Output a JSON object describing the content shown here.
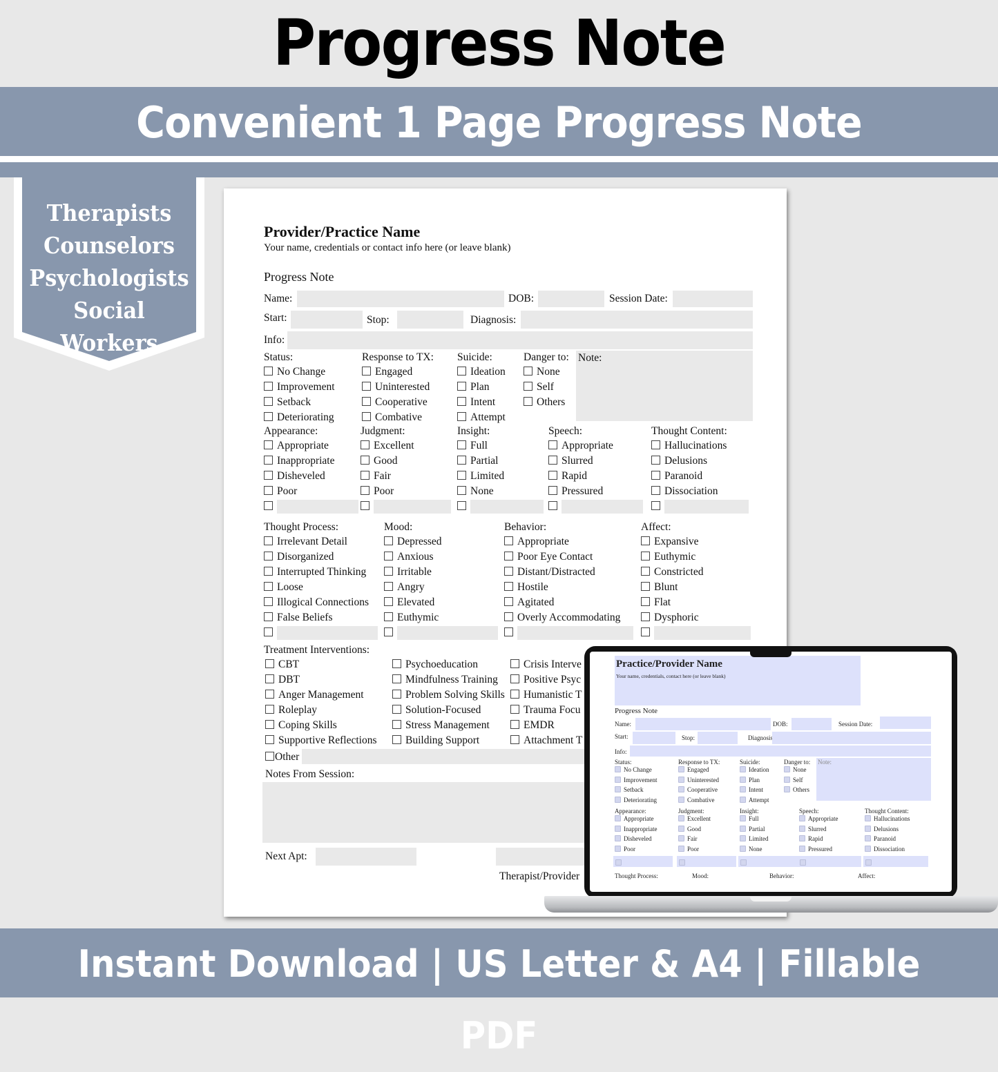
{
  "banner": {
    "title": "Progress Note",
    "subtitle": "Convenient 1 Page Progress Note",
    "audience": [
      "Therapists",
      "Counselors",
      "Psychologists",
      "Social Workers"
    ],
    "footer": "Instant Download | US Letter & A4 | Fillable PDF"
  },
  "colors": {
    "band": "#8897ad",
    "background": "#e8e8e8",
    "field_fill": "#e9e9e9",
    "laptop_field_fill": "#dde1fb"
  },
  "form": {
    "provider_name": "Provider/Practice Name",
    "provider_hint": "Your name, credentials or contact info here (or leave blank)",
    "section_title": "Progress Note",
    "labels": {
      "name": "Name:",
      "dob": "DOB:",
      "session_date": "Session Date:",
      "start": "Start:",
      "stop": "Stop:",
      "diagnosis": "Diagnosis:",
      "info": "Info:",
      "note": "Note:",
      "treatment": "Treatment Interventions:",
      "other": "Other",
      "notes_from_session": "Notes From Session:",
      "next_apt": "Next Apt:",
      "therapist": "Therapist/Provider"
    },
    "group1": [
      {
        "heading": "Status:",
        "items": [
          "No Change",
          "Improvement",
          "Setback",
          "Deteriorating"
        ]
      },
      {
        "heading": "Response to TX:",
        "items": [
          "Engaged",
          "Uninterested",
          "Cooperative",
          "Combative"
        ]
      },
      {
        "heading": "Suicide:",
        "items": [
          "Ideation",
          "Plan",
          "Intent",
          "Attempt"
        ]
      },
      {
        "heading": "Danger to:",
        "items": [
          "None",
          "Self",
          "Others"
        ]
      }
    ],
    "group2": [
      {
        "heading": "Appearance:",
        "items": [
          "Appropriate",
          "Inappropriate",
          "Disheveled",
          "Poor"
        ]
      },
      {
        "heading": "Judgment:",
        "items": [
          "Excellent",
          "Good",
          "Fair",
          "Poor"
        ]
      },
      {
        "heading": "Insight:",
        "items": [
          "Full",
          "Partial",
          "Limited",
          "None"
        ]
      },
      {
        "heading": "Speech:",
        "items": [
          "Appropriate",
          "Slurred",
          "Rapid",
          "Pressured"
        ]
      },
      {
        "heading": "Thought Content:",
        "items": [
          "Hallucinations",
          "Delusions",
          "Paranoid",
          "Dissociation"
        ]
      }
    ],
    "group3": [
      {
        "heading": "Thought Process:",
        "items": [
          "Irrelevant Detail",
          "Disorganized",
          "Interrupted Thinking",
          "Loose",
          "Illogical Connections",
          "False Beliefs"
        ]
      },
      {
        "heading": "Mood:",
        "items": [
          "Depressed",
          "Anxious",
          "Irritable",
          "Angry",
          "Elevated",
          "Euthymic"
        ]
      },
      {
        "heading": "Behavior:",
        "items": [
          "Appropriate",
          "Poor Eye Contact",
          "Distant/Distracted",
          "Hostile",
          "Agitated",
          "Overly Accommodating"
        ]
      },
      {
        "heading": "Affect:",
        "items": [
          "Expansive",
          "Euthymic",
          "Constricted",
          "Blunt",
          "Flat",
          "Dysphoric"
        ]
      }
    ],
    "treatment_columns": [
      [
        "CBT",
        "DBT",
        "Anger Management",
        "Roleplay",
        "Coping Skills",
        "Supportive Reflections"
      ],
      [
        "Psychoeducation",
        "Mindfulness Training",
        "Problem Solving Skills",
        "Solution-Focused",
        "Stress Management",
        "Building Support"
      ],
      [
        "Crisis Interve",
        "Positive Psyc",
        "Humanistic T",
        "Trauma Focu",
        "EMDR",
        "Attachment T"
      ]
    ]
  },
  "laptop_preview": {
    "provider_name": "Practice/Provider Name",
    "provider_hint": "Your name, credentials, contact here (or leave blank)",
    "section_title": "Progress Note",
    "labels": {
      "name": "Name:",
      "dob": "DOB:",
      "session_date": "Session Date:",
      "start": "Start:",
      "stop": "Stop:",
      "diagnosis": "Diagnosis:",
      "info": "Info:",
      "note": "Note:"
    },
    "group1": [
      {
        "heading": "Status:",
        "items": [
          "No Change",
          "Improvement",
          "Setback",
          "Deteriorating"
        ]
      },
      {
        "heading": "Response to TX:",
        "items": [
          "Engaged",
          "Uninterested",
          "Cooperative",
          "Combative"
        ]
      },
      {
        "heading": "Suicide:",
        "items": [
          "Ideation",
          "Plan",
          "Intent",
          "Attempt"
        ]
      },
      {
        "heading": "Danger to:",
        "items": [
          "None",
          "Self",
          "Others"
        ]
      }
    ],
    "group2": [
      {
        "heading": "Appearance:",
        "items": [
          "Appropriate",
          "Inappropriate",
          "Disheveled",
          "Poor"
        ]
      },
      {
        "heading": "Judgment:",
        "items": [
          "Excellent",
          "Good",
          "Fair",
          "Poor"
        ]
      },
      {
        "heading": "Insight:",
        "items": [
          "Full",
          "Partial",
          "Limited",
          "None"
        ]
      },
      {
        "heading": "Speech:",
        "items": [
          "Appropriate",
          "Slurred",
          "Rapid",
          "Pressured"
        ]
      },
      {
        "heading": "Thought Content:",
        "items": [
          "Hallucinations",
          "Delusions",
          "Paranoid",
          "Dissociation"
        ]
      }
    ],
    "group3_headings": [
      "Thought Process:",
      "Mood:",
      "Behavior:",
      "Affect:"
    ]
  }
}
